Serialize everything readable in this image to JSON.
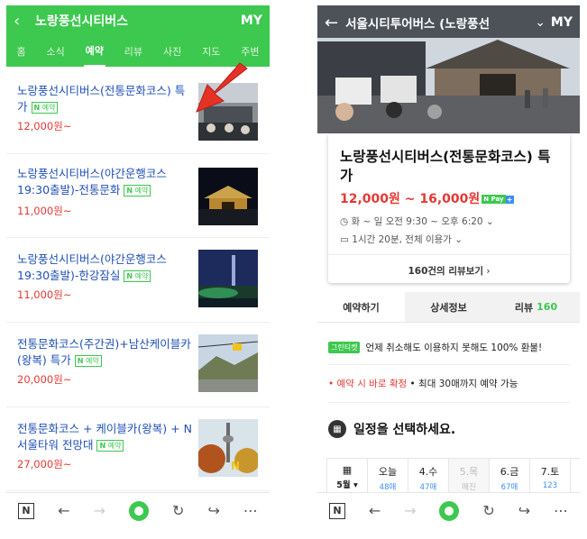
{
  "left": {
    "header": {
      "title": "노랑풍선시티버스",
      "my": "MY"
    },
    "tabs": [
      "홈",
      "소식",
      "예약",
      "리뷰",
      "사진",
      "지도",
      "주변"
    ],
    "active_tab": "예약",
    "badge_label": "예약",
    "items": [
      {
        "title": "노랑풍선시티버스(전통문화코스) 특가",
        "price": "12,000원~"
      },
      {
        "title": "노랑풍선시티버스(야간운행코스19:30출발)-전통문화",
        "price": "11,000원~"
      },
      {
        "title": "노랑풍선시티버스(야간운행코스 19:30출발)-한강잠실",
        "price": "11,000원~"
      },
      {
        "title": "전통문화코스(주간권)+남산케이블카(왕복) 특가",
        "price": "20,000원~"
      },
      {
        "title": "전통문화코스 + 케이블카(왕복) + N서울타워 전망대",
        "price": "27,000원~"
      }
    ]
  },
  "right": {
    "header": {
      "title": "서울시티투어버스 (노랑풍선",
      "my": "MY"
    },
    "product": {
      "name": "노랑풍선시티버스(전통문화코스) 특가",
      "price": "12,000원 ~ 16,000원",
      "npay": "N Pay",
      "hours": "화 ~ 일 오전 9:30 ~ 오후 6:20",
      "duration": "1시간 20분, 전체 이용가",
      "reviews": "160건의 리뷰보기"
    },
    "tabs": {
      "book": "예약하기",
      "detail": "상세정보",
      "review": "리뷰",
      "review_count": "160"
    },
    "guarantee": {
      "badge": "그린티켓",
      "text": "언제 취소해도 이용하지 못해도 100% 환불!"
    },
    "confirm": {
      "red": "• 예약 시 바로 확정",
      "text": "• 최대 30매까지 예약 가능"
    },
    "schedule_title": "일정을 선택하세요.",
    "month": "5월",
    "dates": [
      {
        "label": "오늘",
        "sub": "48매",
        "disabled": false
      },
      {
        "label": "4.수",
        "sub": "47매",
        "disabled": false
      },
      {
        "label": "5.목",
        "sub": "매진",
        "disabled": true
      },
      {
        "label": "6.금",
        "sub": "67매",
        "disabled": false
      },
      {
        "label": "7.토",
        "sub": "123",
        "disabled": false
      }
    ]
  },
  "colors": {
    "naver_green": "#3dc84f",
    "link_blue": "#1f4fb5",
    "price_red": "#e53935"
  }
}
